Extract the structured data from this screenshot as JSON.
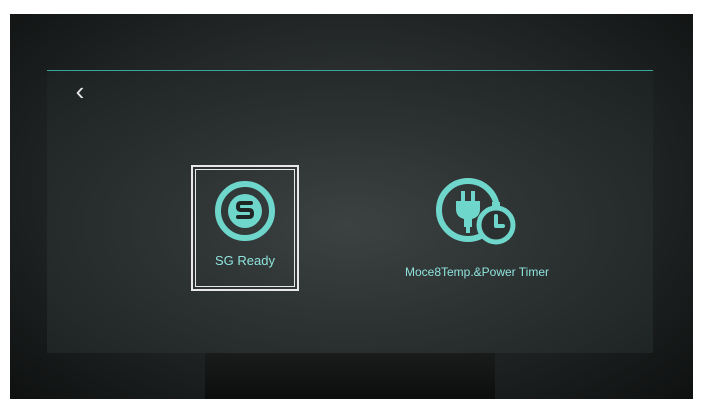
{
  "header": {
    "back_symbol": "‹"
  },
  "tiles": [
    {
      "label": "SG Ready",
      "icon": "sg-ready-icon",
      "selected": true
    },
    {
      "label": "Moce8Temp.&Power Timer",
      "icon": "plug-timer-icon",
      "selected": false
    }
  ],
  "colors": {
    "accent": "#6fd6cc",
    "label": "#8fe3dc",
    "screen": "#2b3131"
  }
}
